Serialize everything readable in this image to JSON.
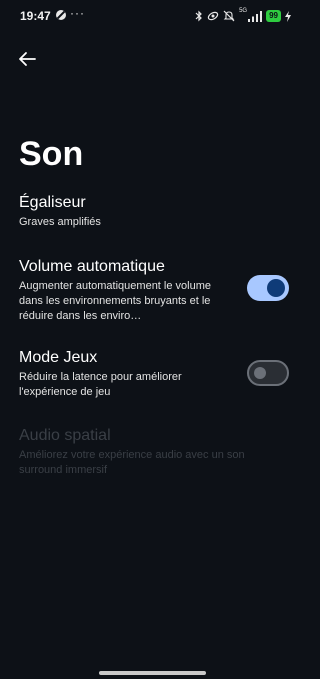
{
  "status_bar": {
    "time": "19:47",
    "more": "···",
    "network_label": "5G",
    "battery": "99",
    "icons": [
      "dnd-icon",
      "bluetooth-icon",
      "link-icon",
      "mute-icon",
      "signal-icon",
      "battery-icon",
      "charging-icon"
    ]
  },
  "header": {
    "back_icon": "arrow-left-icon",
    "title": "Son"
  },
  "settings": {
    "equalizer": {
      "title": "Égaliseur",
      "desc": "Graves amplifiés"
    },
    "auto_volume": {
      "title": "Volume automatique",
      "desc": "Augmenter automatiquement le volume dans les environnements bruyants et le réduire dans les enviro…",
      "enabled": true
    },
    "game_mode": {
      "title": "Mode Jeux",
      "desc": "Réduire la latence pour améliorer l'expérience de jeu",
      "enabled": false
    },
    "spatial_audio": {
      "title": "Audio spatial",
      "desc": "Améliorez votre expérience audio avec un son surround immersif",
      "disabled": true
    }
  },
  "colors": {
    "background": "#0d1117",
    "toggle_on_track": "#a8c8ff",
    "toggle_on_knob": "#0f3b78",
    "battery": "#2ecc40"
  }
}
